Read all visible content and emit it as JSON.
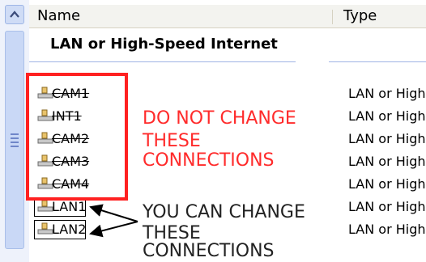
{
  "header": {
    "name": "Name",
    "type": "Type"
  },
  "group": {
    "title": "LAN or High-Speed Internet"
  },
  "rows": [
    {
      "label": "CAM1",
      "type": "LAN or High-S"
    },
    {
      "label": "INT1",
      "type": "LAN or High-S"
    },
    {
      "label": "CAM2",
      "type": "LAN or High-S"
    },
    {
      "label": "CAM3",
      "type": "LAN or High-S"
    },
    {
      "label": "CAM4",
      "type": "LAN or High-S"
    },
    {
      "label": "LAN1",
      "type": "LAN or High-S"
    },
    {
      "label": "LAN2",
      "type": "LAN or High-S"
    }
  ],
  "annotations": {
    "red": [
      "DO NOT CHANGE",
      "THESE",
      "CONNECTIONS"
    ],
    "black": [
      "YOU CAN CHANGE",
      "THESE",
      "CONNECTIONS"
    ]
  },
  "colors": {
    "annotation_red": "#ff2121",
    "selection_blue": "#9fb3e5"
  },
  "icons": {
    "connection": "network-connection-icon",
    "scroll_up": "scroll-up-arrow-icon"
  }
}
